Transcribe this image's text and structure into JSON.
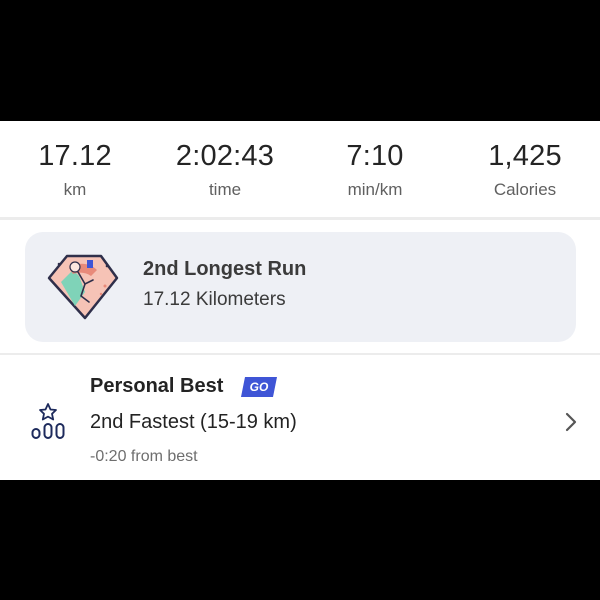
{
  "stats": [
    {
      "value": "17.12",
      "unit": "km"
    },
    {
      "value": "2:02:43",
      "unit": "time"
    },
    {
      "value": "7:10",
      "unit": "min/km"
    },
    {
      "value": "1,425",
      "unit": "Calories"
    }
  ],
  "achievement": {
    "title": "2nd Longest Run",
    "subtitle": "17.12 Kilometers",
    "badge_icon": "running-trophy-badge-icon"
  },
  "personal_best": {
    "label": "Personal Best",
    "tag": "GO",
    "detail": "2nd Fastest (15-19 km)",
    "note": "-0:20 from best",
    "icon": "leaderboard-star-icon",
    "chevron_icon": "chevron-right-icon"
  },
  "colors": {
    "card_bg": "#eef0f5",
    "go_blue": "#3f55d6",
    "icon_navy": "#1d2a5c",
    "badge_pink": "#f6b9ad",
    "badge_teal": "#7fd3b8"
  }
}
